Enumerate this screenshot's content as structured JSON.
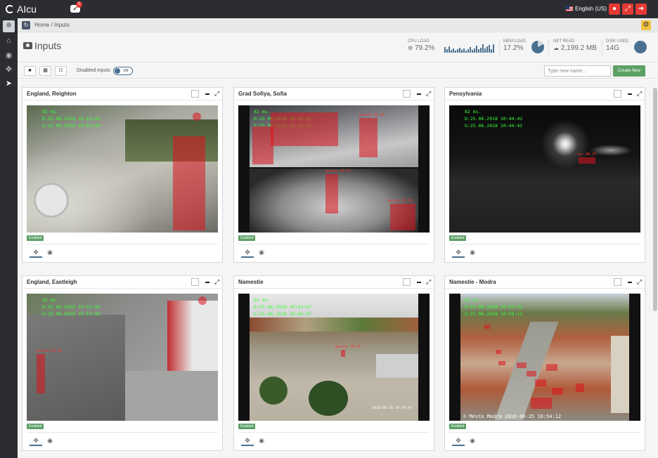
{
  "app": {
    "title": "AIcu",
    "notification_count": "0",
    "notification_glyph": "✓",
    "language": "English (US)",
    "language_caret": "⌄"
  },
  "breadcrumb": {
    "home": "Home",
    "separator": "/",
    "current": "Inputs"
  },
  "page": {
    "title": "Inputs"
  },
  "stats": {
    "cpu": {
      "label": "CPU LOAD",
      "value": "79.2%"
    },
    "mem": {
      "label": "MEM LOAD",
      "value": "17.2%",
      "fraction": 0.172
    },
    "net": {
      "label": "NET READ",
      "value": "2,199.2 MB"
    },
    "disk": {
      "label": "DISK USED",
      "value": "14G"
    }
  },
  "toolbar": {
    "disabled_inputs_label": "Disabled inputs",
    "toggle_text": "ON",
    "name_placeholder": "Type new name...",
    "create_label": "Create New"
  },
  "cards": [
    {
      "title": "England, Reighton",
      "badge": "Enabled",
      "osd": [
        "82 ms.",
        "D:25.06.2018 10:53:49",
        "G:25.06.2018 10:53:49"
      ]
    },
    {
      "title": "Grad Sofiya, Sofia",
      "badge": "Enabled",
      "osd": [
        "82 ms.",
        "D:25.06.2018 10:44:42",
        "G:25.06.2018 10:44:42"
      ],
      "labels": [
        "person 92.4%",
        "person 87.1%",
        "person 81.0%"
      ]
    },
    {
      "title": "Pensylvania",
      "badge": "Enabled",
      "osd": [
        "82 ms.",
        "D:25.06.2018 10:44:42",
        "G:25.06.2018 10:44:42"
      ],
      "labels": [
        "car 88.2%"
      ]
    },
    {
      "title": "England, Eastleigh",
      "badge": "Enabled",
      "osd": [
        "82 ms.",
        "D:25.06.2018 10:53:49",
        "G:25.06.2018 10:53:49"
      ],
      "labels": [
        "person 62.5%"
      ]
    },
    {
      "title": "Namestie",
      "badge": "Enabled",
      "osd": [
        "82 ms.",
        "D:25.06.2018 10:54:47",
        "G:25.06.2018 10:54:47"
      ],
      "labels": [
        "person 79.5%"
      ],
      "stamp": "2018-06-25 10:54:47"
    },
    {
      "title": "Namestie - Modra",
      "badge": "Enabled",
      "osd": [
        "82 ms.",
        "D:25.06.2018 10:54:12",
        "G:25.06.2018 10:54:12"
      ],
      "caption": "© Mesto Modra 2018-06-25 10:54:12"
    }
  ]
}
